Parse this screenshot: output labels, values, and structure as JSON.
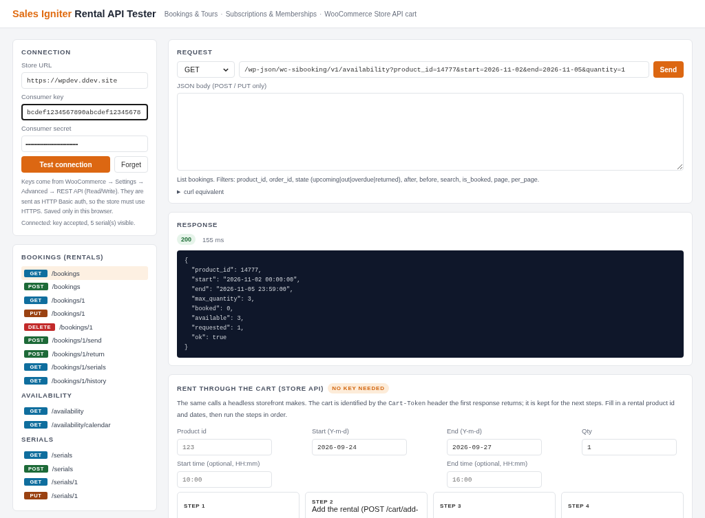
{
  "header": {
    "brand_accent": "Sales Igniter",
    "brand_rest": "Rental API Tester",
    "links": [
      "Bookings & Tours",
      "Subscriptions & Memberships",
      "WooCommerce Store API cart"
    ],
    "separator": "·"
  },
  "connection": {
    "title": "CONNECTION",
    "fields": [
      {
        "kind": "text",
        "label": "Store URL",
        "value": "https://wpdev.ddev.site",
        "focused": false
      },
      {
        "kind": "text",
        "label": "Consumer key",
        "value": "bcdef1234567890abcdef12345678",
        "focused": true
      },
      {
        "kind": "password",
        "label": "Consumer secret",
        "value": "•••••••••••••••••••••••••••••••••••••••••",
        "focused": false
      }
    ],
    "test_button": "Test connection",
    "forget_button": "Forget",
    "help": "Keys come from WooCommerce → Settings → Advanced → REST API (Read/Write). They are sent as HTTP Basic auth, so the store must use HTTPS. Saved only in this browser.",
    "status": "Connected: key accepted, 5 serial(s) visible."
  },
  "endpoints": [
    {
      "title": "BOOKINGS (RENTALS)",
      "items": [
        {
          "method": "GET",
          "color": "#0f6e9e",
          "path": "/bookings",
          "selected": true
        },
        {
          "method": "POST",
          "color": "#1d6a38",
          "path": "/bookings",
          "selected": false
        },
        {
          "method": "GET",
          "color": "#0f6e9e",
          "path": "/bookings/1",
          "selected": false
        },
        {
          "method": "PUT",
          "color": "#9a4212",
          "path": "/bookings/1",
          "selected": false
        },
        {
          "method": "DELETE",
          "color": "#c22a2a",
          "path": "/bookings/1",
          "selected": false
        },
        {
          "method": "POST",
          "color": "#1d6a38",
          "path": "/bookings/1/send",
          "selected": false
        },
        {
          "method": "POST",
          "color": "#1d6a38",
          "path": "/bookings/1/return",
          "selected": false
        },
        {
          "method": "GET",
          "color": "#0f6e9e",
          "path": "/bookings/1/serials",
          "selected": false
        },
        {
          "method": "GET",
          "color": "#0f6e9e",
          "path": "/bookings/1/history",
          "selected": false
        }
      ]
    },
    {
      "title": "AVAILABILITY",
      "items": [
        {
          "method": "GET",
          "color": "#0f6e9e",
          "path": "/availability",
          "selected": false
        },
        {
          "method": "GET",
          "color": "#0f6e9e",
          "path": "/availability/calendar",
          "selected": false
        }
      ]
    },
    {
      "title": "SERIALS",
      "items": [
        {
          "method": "GET",
          "color": "#0f6e9e",
          "path": "/serials",
          "selected": false
        },
        {
          "method": "POST",
          "color": "#1d6a38",
          "path": "/serials",
          "selected": false
        },
        {
          "method": "GET",
          "color": "#0f6e9e",
          "path": "/serials/1",
          "selected": false
        },
        {
          "method": "PUT",
          "color": "#9a4212",
          "path": "/serials/1",
          "selected": false
        }
      ]
    }
  ],
  "request": {
    "title": "REQUEST",
    "method": "GET",
    "url": "/wp-json/wc-sibooking/v1/availability?product_id=14777&start=2026-11-02&end=2026-11-05&quantity=1",
    "send_button": "Send",
    "body_label": "JSON body (POST / PUT only)",
    "hint": "List bookings. Filters: product_id, order_id, state (upcoming|out|overdue|returned), after, before, search, is_booked, page, per_page.",
    "curl_toggle": "▶",
    "curl_label": "curl equivalent"
  },
  "response": {
    "title": "RESPONSE",
    "status": "200",
    "time": "155 ms",
    "body_lines": [
      "{",
      "  \"product_id\": 14777,",
      "  \"start\": \"2026-11-02 00:00:00\",",
      "  \"end\": \"2026-11-05 23:59:00\",",
      "  \"max_quantity\": 3,",
      "  \"booked\": 0,",
      "  \"available\": 3,",
      "  \"requested\": 1,",
      "  \"ok\": true",
      "}"
    ]
  },
  "cart": {
    "title": "RENT THROUGH THE CART (STORE API)",
    "badge": "NO KEY NEEDED",
    "description": {
      "before": "The same calls a headless storefront makes. The cart is identified by the ",
      "code": "Cart-Token",
      "after": " header the first response returns; it is kept for the next steps. Fill in a rental product id and dates, then run the steps in order."
    },
    "fields": [
      {
        "label": "Product id",
        "placeholder": "123"
      },
      {
        "label": "Start (Y-m-d)",
        "value": "2026-09-24"
      },
      {
        "label": "End (Y-m-d)",
        "value": "2026-09-27"
      },
      {
        "label": "Qty",
        "value": "1"
      },
      {
        "label": "Start time (optional, HH:mm)",
        "placeholder": "10:00"
      },
      {
        "label": "End time (optional, HH:mm)",
        "placeholder": "16:00"
      }
    ],
    "steps": [
      {
        "label": "STEP 1"
      },
      {
        "label": "STEP 2",
        "text": "Add the rental (POST /cart/add-"
      },
      {
        "label": "STEP 3"
      },
      {
        "label": "STEP 4"
      }
    ]
  }
}
